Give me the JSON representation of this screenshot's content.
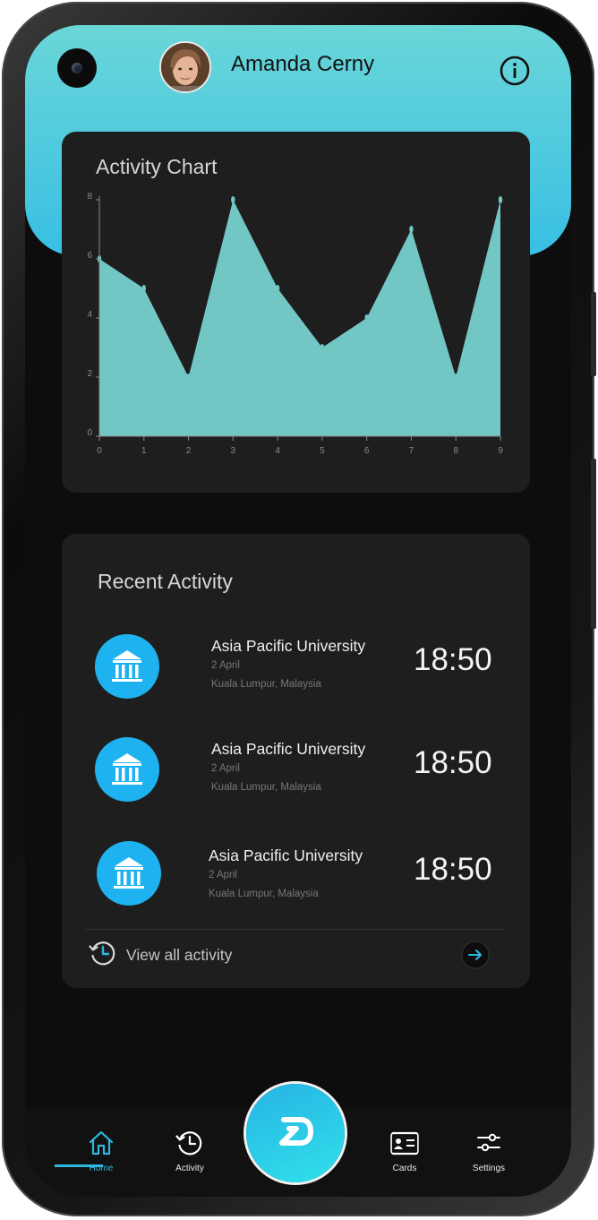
{
  "header": {
    "user_name": "Amanda Cerny"
  },
  "chart_data": {
    "type": "area",
    "title": "Activity Chart",
    "x": [
      0,
      1,
      2,
      3,
      4,
      5,
      6,
      7,
      8,
      9
    ],
    "values": [
      6,
      5,
      2,
      8,
      5,
      3,
      4,
      7,
      2,
      8
    ],
    "x_ticks": [
      "0",
      "1",
      "2",
      "3",
      "4",
      "5",
      "6",
      "7",
      "8",
      "9"
    ],
    "y_ticks": [
      "0",
      "2",
      "4",
      "6",
      "8"
    ],
    "ylim": [
      0,
      8
    ],
    "xlim": [
      0,
      9
    ],
    "grid": false,
    "fill_color": "#72c7c4"
  },
  "recent_activity": {
    "title": "Recent Activity",
    "items": [
      {
        "place": "Asia Pacific University",
        "date": "2 April",
        "location": "Kuala Lumpur, Malaysia",
        "time": "18:50"
      },
      {
        "place": "Asia Pacific University",
        "date": "2 April",
        "location": "Kuala Lumpur, Malaysia",
        "time": "18:50"
      },
      {
        "place": "Asia Pacific University",
        "date": "2 April",
        "location": "Kuala Lumpur, Malaysia",
        "time": "18:50"
      }
    ],
    "view_all_label": "View all activity"
  },
  "nav": {
    "home": "Home",
    "activity": "Activity",
    "cards": "Cards",
    "settings": "Settings",
    "active_color": "#2fb7de"
  },
  "colors": {
    "accent": "#1eb3f0",
    "header_top": "#6ad6d8",
    "header_bottom": "#38bfe4",
    "card_bg": "#1e1e1e"
  }
}
